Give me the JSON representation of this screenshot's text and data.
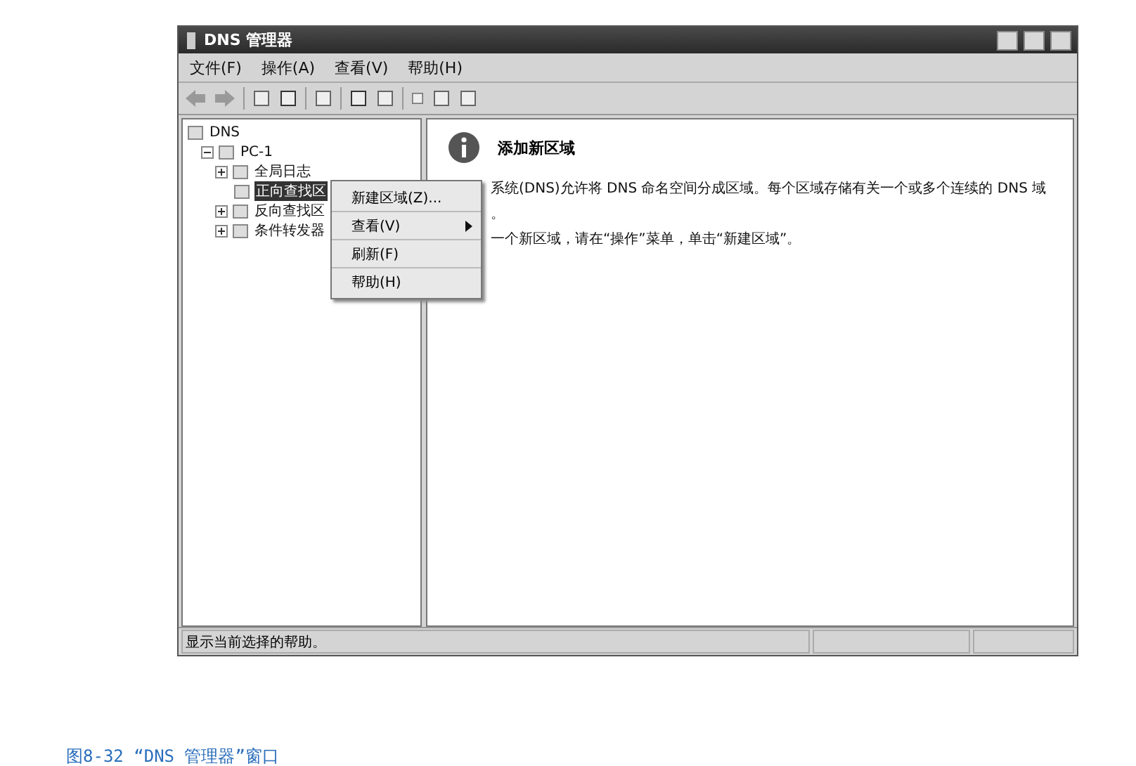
{
  "window": {
    "title": "DNS 管理器"
  },
  "menu_bar": [
    "文件(F)",
    "操作(A)",
    "查看(V)",
    "帮助(H)"
  ],
  "tree": [
    {
      "label": "DNS",
      "selected": false,
      "children": [
        {
          "label": "PC-1",
          "selected": false,
          "expanded": true,
          "children": [
            {
              "label": "全局日志",
              "selected": false,
              "expanded": false
            },
            {
              "label": "正向查找区",
              "selected": true
            },
            {
              "label": "反向查找区",
              "selected": false,
              "expanded": false
            },
            {
              "label": "条件转发器",
              "selected": false,
              "expanded": false
            }
          ]
        }
      ]
    }
  ],
  "context_menu": [
    {
      "label": "新建区域(Z)...",
      "submenu": false
    },
    {
      "label": "查看(V)",
      "submenu": true
    },
    {
      "label": "刷新(F)",
      "submenu": false
    },
    {
      "label": "帮助(H)",
      "submenu": false
    }
  ],
  "details": {
    "heading": "添加新区域",
    "paragraphs": [
      "系统(DNS)允许将 DNS 命名空间分成区域。每个区域存储有关一个或多个连续的 DNS 域",
      "。",
      "一个新区域，请在“操作”菜单，单击“新建区域”。"
    ]
  },
  "status_bar": "显示当前选择的帮助。",
  "caption": "图8-32 “DNS 管理器”窗口"
}
